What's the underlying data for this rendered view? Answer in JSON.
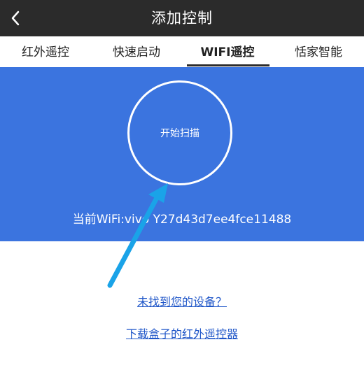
{
  "header": {
    "title": "添加控制",
    "back_icon": "chevron-left-icon"
  },
  "tabs": [
    {
      "label": "红外遥控",
      "active": false
    },
    {
      "label": "快速启动",
      "active": false
    },
    {
      "label": "WIFI遥控",
      "active": true
    },
    {
      "label": "恬家智能",
      "active": false
    }
  ],
  "scan": {
    "button_label": "开始扫描",
    "wifi_text": "当前WiFi:vivo Y27d43d7ee4fce11488"
  },
  "links": {
    "not_found": "未找到您的设备？",
    "download_remote": "下载盒子的红外遥控器"
  },
  "colors": {
    "header_bg": "#2b2b2b",
    "panel_bg": "#3b74df",
    "link": "#1f56c8",
    "annotation_arrow": "#1aa3e8"
  }
}
